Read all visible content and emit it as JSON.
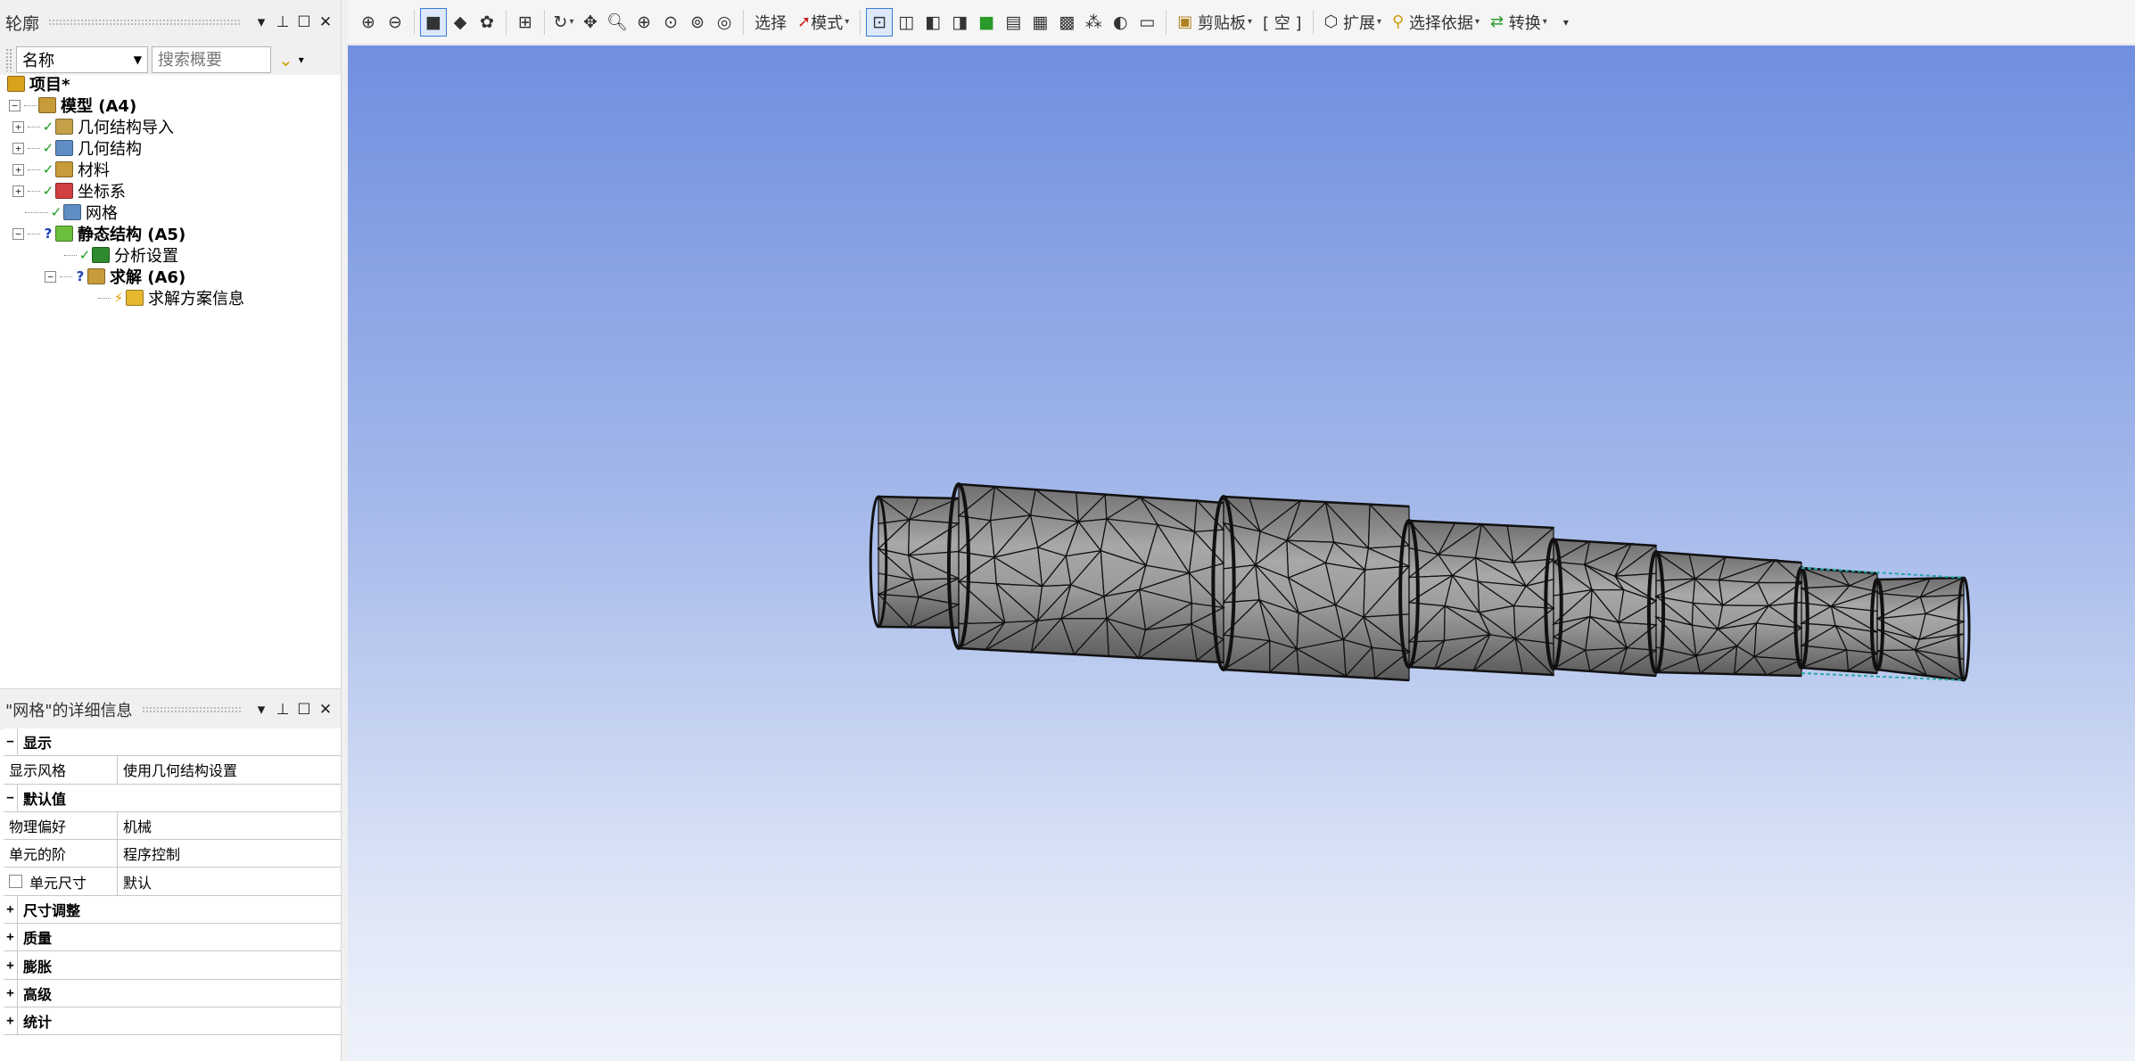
{
  "outline": {
    "title": "轮廓",
    "controls": [
      "▼",
      "📌",
      "☐",
      "✕"
    ],
    "filter": {
      "select_value": "名称",
      "search_placeholder": "搜索概要"
    },
    "tree": [
      {
        "label": "项目*",
        "bold": true,
        "status": "",
        "icon": "project-icon",
        "icon_color": "#d8a21b",
        "expander": ""
      },
      {
        "label": "模型 (A4)",
        "bold": true,
        "status": "",
        "icon": "model-icon",
        "icon_color": "#c89b3a",
        "expander": "⊟"
      },
      {
        "label": "几何结构导入",
        "bold": false,
        "status": "✓",
        "icon": "geometry-import-icon",
        "icon_color": "#c4a048",
        "expander": "⊞"
      },
      {
        "label": "几何结构",
        "bold": false,
        "status": "✓",
        "icon": "geometry-icon",
        "icon_color": "#5f8ec4",
        "expander": "⊞"
      },
      {
        "label": "材料",
        "bold": false,
        "status": "✓",
        "icon": "materials-icon",
        "icon_color": "#c89b3a",
        "expander": "⊞"
      },
      {
        "label": "坐标系",
        "bold": false,
        "status": "✓",
        "icon": "coordinate-system-icon",
        "icon_color": "#d04040",
        "expander": "⊞"
      },
      {
        "label": "网格",
        "bold": false,
        "status": "✓",
        "icon": "mesh-icon",
        "icon_color": "#5f8ec4",
        "expander": ""
      },
      {
        "label": "静态结构 (A5)",
        "bold": true,
        "status": "?",
        "icon": "static-structural-icon",
        "icon_color": "#6cbf3c",
        "expander": "⊟"
      },
      {
        "label": "分析设置",
        "bold": false,
        "status": "✓",
        "icon": "analysis-settings-icon",
        "icon_color": "#2e8a2e",
        "expander": ""
      },
      {
        "label": "求解 (A6)",
        "bold": true,
        "status": "?",
        "icon": "solution-icon",
        "icon_color": "#c89b3a",
        "expander": "⊟"
      },
      {
        "label": "求解方案信息",
        "bold": false,
        "status": "⚡",
        "icon": "solution-info-icon",
        "icon_color": "#e6b830",
        "expander": ""
      }
    ]
  },
  "details": {
    "title": "\"网格\"的详细信息",
    "rows": [
      {
        "type": "cat",
        "exp": "⊟",
        "label": "显示"
      },
      {
        "type": "prop",
        "key": "显示风格",
        "value": "使用几何结构设置"
      },
      {
        "type": "cat",
        "exp": "⊟",
        "label": "默认值"
      },
      {
        "type": "prop",
        "key": "物理偏好",
        "value": "机械"
      },
      {
        "type": "prop",
        "key": "单元的阶",
        "value": "程序控制"
      },
      {
        "type": "propchk",
        "key": "单元尺寸",
        "value": "默认"
      },
      {
        "type": "cat",
        "exp": "⊞",
        "label": "尺寸调整"
      },
      {
        "type": "cat",
        "exp": "⊞",
        "label": "质量"
      },
      {
        "type": "cat",
        "exp": "⊞",
        "label": "膨胀"
      },
      {
        "type": "cat",
        "exp": "⊞",
        "label": "高级"
      },
      {
        "type": "cat",
        "exp": "⊞",
        "label": "统计"
      }
    ]
  },
  "toolbar": {
    "select_label": "选择",
    "mode_label": "模式",
    "clipboard_label": "剪贴板",
    "empty_label": "[ 空 ]",
    "extend_label": "扩展",
    "select_by_label": "选择依据",
    "convert_label": "转换"
  },
  "viewport": {
    "bg_top": "#6f8fdf",
    "bg_bottom": "#eef2fb",
    "mesh_color": "#111111"
  }
}
